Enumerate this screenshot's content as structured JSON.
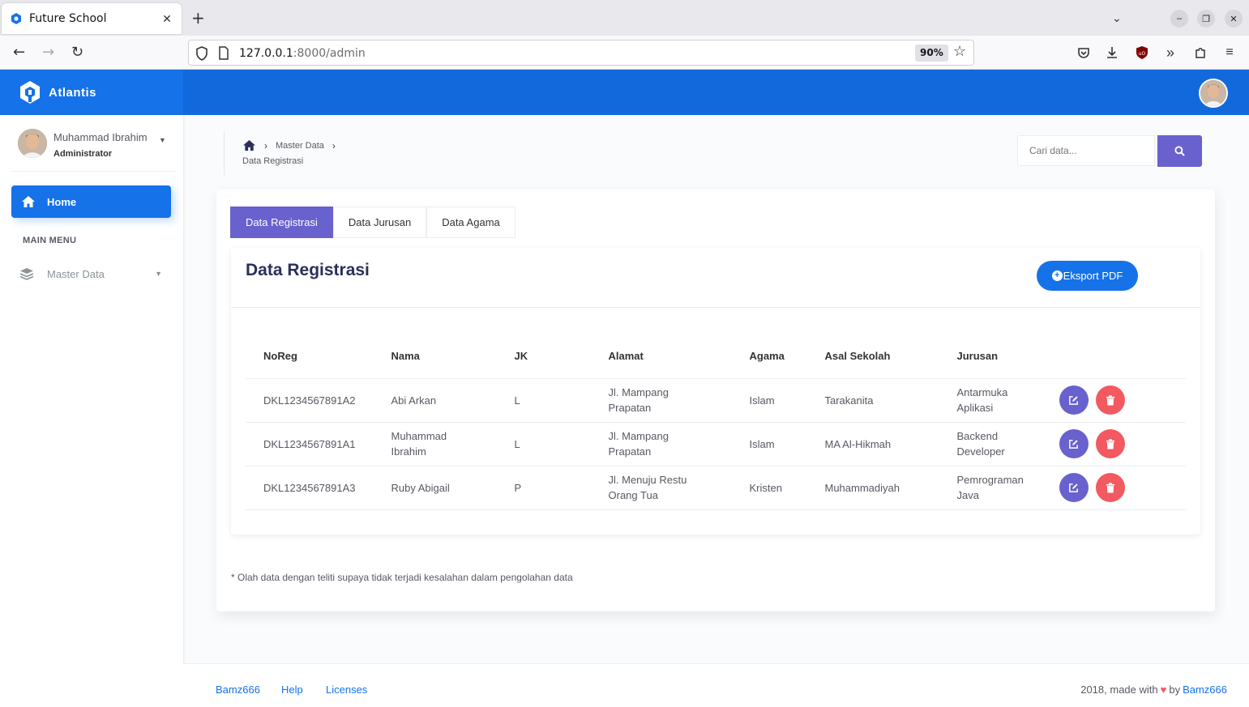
{
  "browser": {
    "tab_title": "Future School",
    "url_host": "127.0.0.1",
    "url_rest": ":8000/admin",
    "zoom": "90%"
  },
  "app": {
    "brand": "Atlantis",
    "accent": "#1572e8",
    "secondary": "#6861ce",
    "danger": "#f25961"
  },
  "sidebar": {
    "user_name": "Muhammad Ibrahim",
    "user_role": "Administrator",
    "home_label": "Home",
    "section_title": "MAIN MENU",
    "master_label": "Master Data"
  },
  "breadcrumb": {
    "level1": "Master Data",
    "current": "Data Registrasi"
  },
  "search": {
    "placeholder": "Cari data..."
  },
  "tabs": [
    "Data Registrasi",
    "Data Jurusan",
    "Data Agama"
  ],
  "card": {
    "title": "Data Registrasi",
    "export_label": "Eksport PDF"
  },
  "table": {
    "headers": [
      "NoReg",
      "Nama",
      "JK",
      "Alamat",
      "Agama",
      "Asal Sekolah",
      "Jurusan"
    ],
    "rows": [
      [
        "DKL1234567891A2",
        "Abi Arkan",
        "L",
        "Jl. Mampang Prapatan",
        "Islam",
        "Tarakanita",
        "Antarmuka Aplikasi"
      ],
      [
        "DKL1234567891A1",
        "Muhammad Ibrahim",
        "L",
        "Jl. Mampang Prapatan",
        "Islam",
        "MA Al-Hikmah",
        "Backend Developer"
      ],
      [
        "DKL1234567891A3",
        "Ruby Abigail",
        "P",
        "Jl. Menuju Restu Orang Tua",
        "Kristen",
        "Muhammadiyah",
        "Pemrograman Java"
      ]
    ]
  },
  "note": "* Olah data dengan teliti supaya tidak terjadi kesalahan dalam pengolahan data",
  "footer": {
    "links": [
      "Bamz666",
      "Help",
      "Licenses"
    ],
    "made_prefix": "2018, made with",
    "made_by": "by",
    "author": "Bamz666"
  }
}
